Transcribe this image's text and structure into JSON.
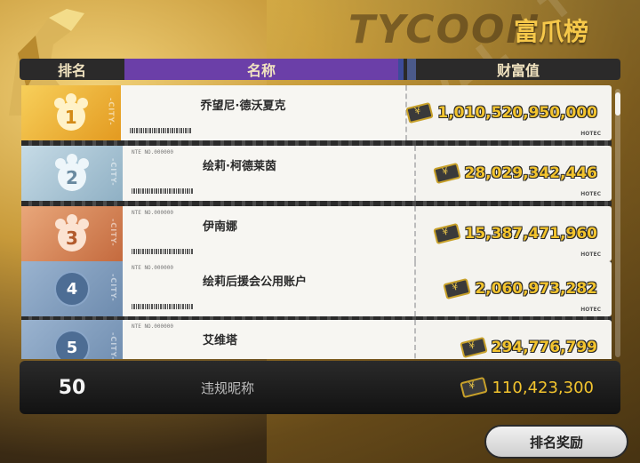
{
  "board": {
    "bg_title": "TYCOON",
    "title": "富爪榜"
  },
  "header": {
    "rank": "排名",
    "name": "名称",
    "wealth": "财富值"
  },
  "ticket": {
    "tag": "NTE NO.000000",
    "city": "-CITY-",
    "brand": "HOTEC"
  },
  "rows": [
    {
      "rank": "1",
      "name": "乔望尼·德沃夏克",
      "wealth": "1,010,520,950,000",
      "tier": "gold",
      "accent": "#f2b93a"
    },
    {
      "rank": "2",
      "name": "绘莉·柯德莱茵",
      "wealth": "28,029,342,446",
      "tier": "silver",
      "accent": "#a9c3d2"
    },
    {
      "rank": "3",
      "name": "伊南娜",
      "wealth": "15,387,471,960",
      "tier": "bronze",
      "accent": "#d98a5a"
    },
    {
      "rank": "4",
      "name": "绘莉后援会公用账户",
      "wealth": "2,060,973,282",
      "tier": "blue",
      "accent": "#7b97b8"
    },
    {
      "rank": "5",
      "name": "艾维塔",
      "wealth": "294,776,799",
      "tier": "blue",
      "accent": "#7b97b8"
    }
  ],
  "self": {
    "rank": "50",
    "name": "违规昵称",
    "wealth": "110,423,300"
  },
  "reward_button": "排名奖励",
  "icons": [
    "paw-icon",
    "money-icon",
    "statue-art"
  ]
}
